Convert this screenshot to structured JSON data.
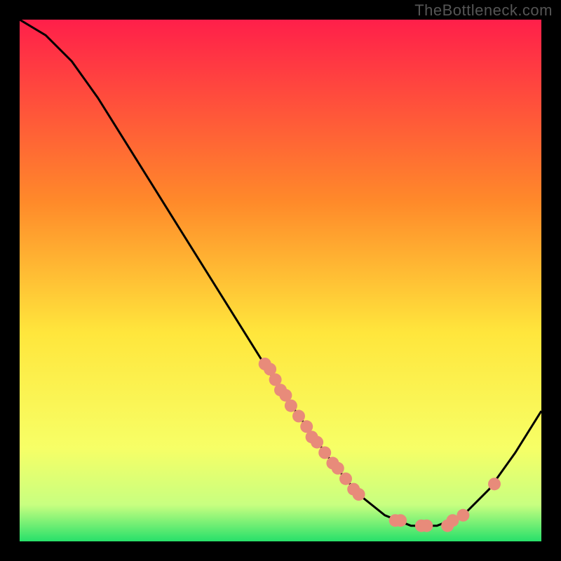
{
  "watermark": "TheBottleneck.com",
  "colors": {
    "frame": "#000000",
    "curve": "#000000",
    "point": "#e88b7a",
    "grad_top": "#ff1f4a",
    "grad_mid1": "#ff8a2a",
    "grad_mid2": "#ffe63c",
    "grad_low1": "#f7ff66",
    "grad_low2": "#c8ff80",
    "grad_bottom": "#27e06a"
  },
  "chart_data": {
    "type": "line",
    "title": "",
    "xlabel": "",
    "ylabel": "",
    "xlim": [
      0,
      100
    ],
    "ylim": [
      0,
      100
    ],
    "curve": [
      {
        "x": 0,
        "y": 100
      },
      {
        "x": 5,
        "y": 97
      },
      {
        "x": 10,
        "y": 92
      },
      {
        "x": 15,
        "y": 85
      },
      {
        "x": 20,
        "y": 77
      },
      {
        "x": 25,
        "y": 69
      },
      {
        "x": 30,
        "y": 61
      },
      {
        "x": 35,
        "y": 53
      },
      {
        "x": 40,
        "y": 45
      },
      {
        "x": 45,
        "y": 37
      },
      {
        "x": 50,
        "y": 29
      },
      {
        "x": 55,
        "y": 22
      },
      {
        "x": 60,
        "y": 15
      },
      {
        "x": 65,
        "y": 9
      },
      {
        "x": 70,
        "y": 5
      },
      {
        "x": 75,
        "y": 3
      },
      {
        "x": 80,
        "y": 3
      },
      {
        "x": 85,
        "y": 5
      },
      {
        "x": 90,
        "y": 10
      },
      {
        "x": 95,
        "y": 17
      },
      {
        "x": 100,
        "y": 25
      }
    ],
    "points": [
      {
        "x": 47,
        "y": 34
      },
      {
        "x": 48,
        "y": 33
      },
      {
        "x": 49,
        "y": 31
      },
      {
        "x": 50,
        "y": 29
      },
      {
        "x": 51,
        "y": 28
      },
      {
        "x": 52,
        "y": 26
      },
      {
        "x": 53.5,
        "y": 24
      },
      {
        "x": 55,
        "y": 22
      },
      {
        "x": 56,
        "y": 20
      },
      {
        "x": 57,
        "y": 19
      },
      {
        "x": 58.5,
        "y": 17
      },
      {
        "x": 60,
        "y": 15
      },
      {
        "x": 61,
        "y": 14
      },
      {
        "x": 62.5,
        "y": 12
      },
      {
        "x": 64,
        "y": 10
      },
      {
        "x": 65,
        "y": 9
      },
      {
        "x": 72,
        "y": 4
      },
      {
        "x": 73,
        "y": 4
      },
      {
        "x": 77,
        "y": 3
      },
      {
        "x": 78,
        "y": 3
      },
      {
        "x": 82,
        "y": 3
      },
      {
        "x": 83,
        "y": 4
      },
      {
        "x": 85,
        "y": 5
      },
      {
        "x": 91,
        "y": 11
      }
    ]
  }
}
